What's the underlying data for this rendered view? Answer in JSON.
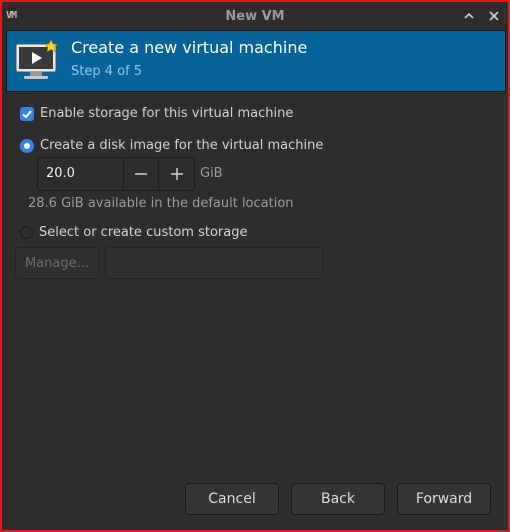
{
  "window": {
    "title": "New VM",
    "logo_text": "VM"
  },
  "header": {
    "title": "Create a new virtual machine",
    "step": "Step 4 of 5"
  },
  "storage": {
    "enable_label": "Enable storage for this virtual machine",
    "create_disk_label": "Create a disk image for the virtual machine",
    "size_value": "20.0",
    "size_unit": "GiB",
    "available_text": "28.6 GiB available in the default location",
    "custom_label": "Select or create custom storage",
    "manage_label": "Manage...",
    "path_value": ""
  },
  "footer": {
    "cancel": "Cancel",
    "back": "Back",
    "forward": "Forward"
  },
  "colors": {
    "accent": "#3584e4",
    "header_bg": "#06639a",
    "border": "#e01b1b"
  },
  "icons": {
    "minimize": "chevron-up-icon",
    "close": "close-icon",
    "decrement": "minus-icon",
    "increment": "plus-icon"
  }
}
